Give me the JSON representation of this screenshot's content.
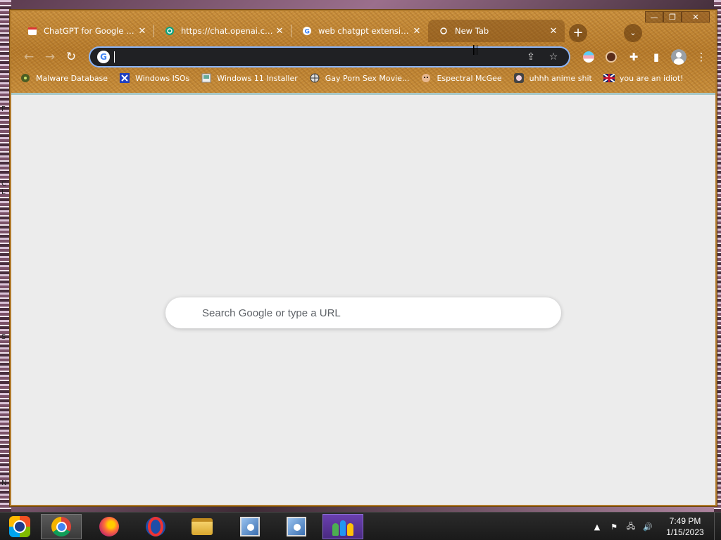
{
  "window": {
    "controls": {
      "minimize": "—",
      "maximize": "❐",
      "close": "✕"
    }
  },
  "tabs": [
    {
      "title": "ChatGPT for Google - Chrome",
      "favicon": "chatgpt-google-favicon",
      "close": "✕",
      "active": false
    },
    {
      "title": "https://chat.openai.com",
      "favicon": "openai-favicon",
      "close": "✕",
      "active": false
    },
    {
      "title": "web chatgpt extension - Google",
      "favicon": "google-favicon",
      "close": "✕",
      "active": false
    },
    {
      "title": "New Tab",
      "favicon": "newtab-favicon",
      "close": "✕",
      "active": true
    }
  ],
  "tabstrip": {
    "new_tab": "+",
    "tab_search": "⌄"
  },
  "toolbar": {
    "back": "←",
    "forward": "→",
    "reload": "↻",
    "omnibox_value": "",
    "share": "⇪",
    "bookmark_star": "☆",
    "extensions": "✚",
    "side_panel": "▮",
    "menu": "⋮"
  },
  "bookmarks": [
    {
      "label": "Malware Database",
      "icon": "biohazard-icon"
    },
    {
      "label": "Windows ISOs",
      "icon": "x-logo-icon"
    },
    {
      "label": "Windows 11 Installer",
      "icon": "installer-icon"
    },
    {
      "label": "Gay Porn Sex Movie...",
      "icon": "globe-icon"
    },
    {
      "label": "Espectral McGee",
      "icon": "face-icon"
    },
    {
      "label": "uhhh anime shit",
      "icon": "anime-icon"
    },
    {
      "label": "you are an idiot!",
      "icon": "flag-uk-icon"
    }
  ],
  "ntp": {
    "search_placeholder": "Search Google or type a URL"
  },
  "taskbar": {
    "apps": [
      "chrome",
      "firefox",
      "opera",
      "file-explorer",
      "installer",
      "installer",
      "people"
    ],
    "tray": {
      "arrow": "▲",
      "flag": "⚑",
      "network": "🖧",
      "volume": "🔊"
    },
    "time": "7:49 PM",
    "date": "1/15/2023"
  },
  "desktop_fragments": [
    "F",
    "C",
    "L",
    "S",
    "N"
  ],
  "colors": {
    "omnibox_bg": "#202124",
    "omnibox_focus": "#8ab4f8",
    "frame": "#c98f3c",
    "ntp_bg": "#ececec"
  }
}
